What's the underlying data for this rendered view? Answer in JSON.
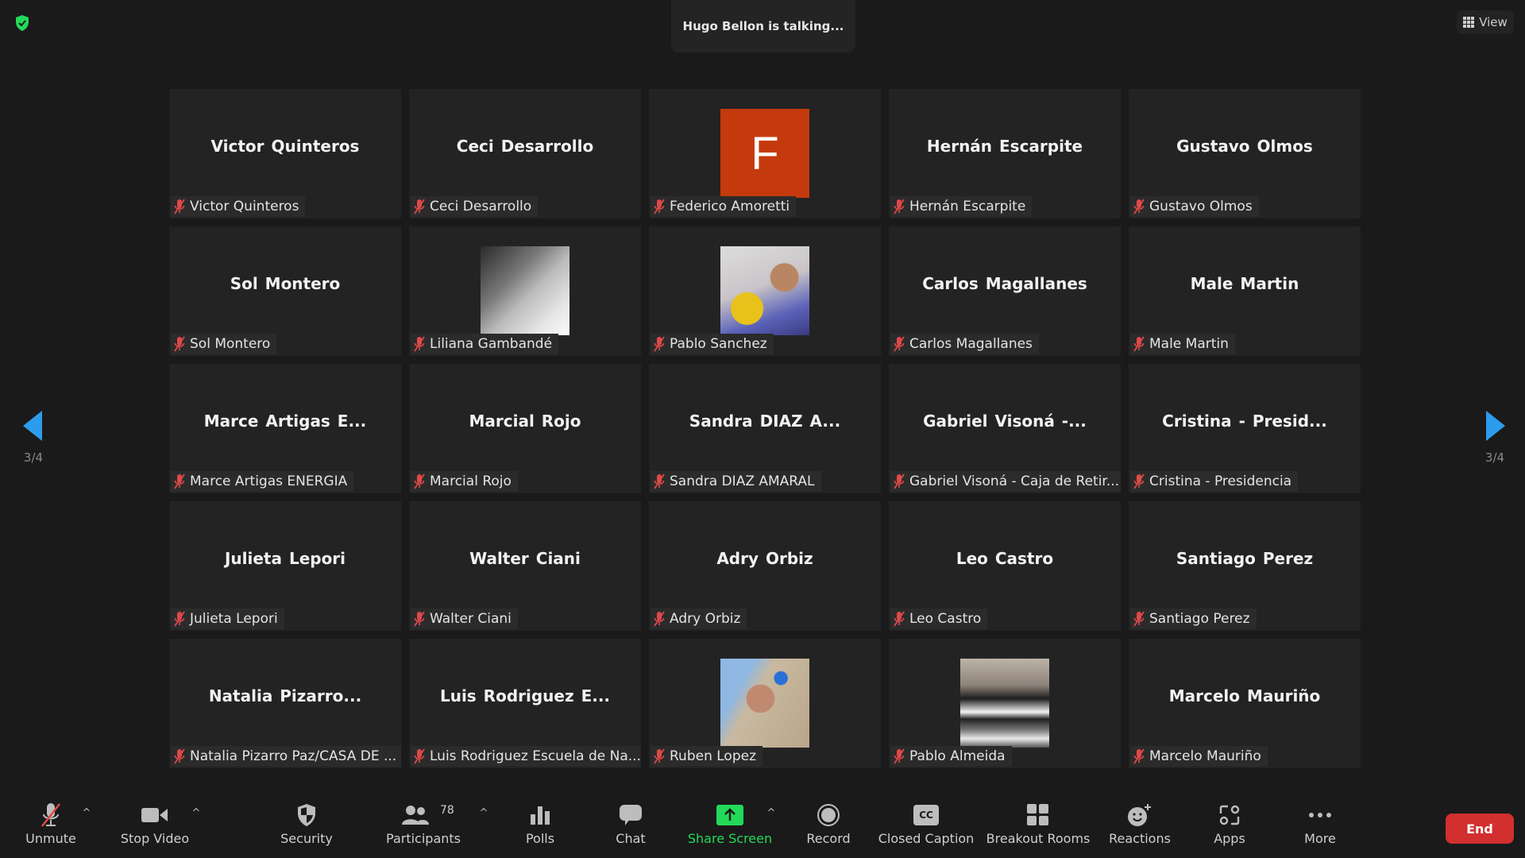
{
  "top": {
    "talking_indicator": "Hugo Bellon is talking...",
    "view_label": "View"
  },
  "pager": {
    "left_page": "3/4",
    "right_page": "3/4"
  },
  "tiles": [
    {
      "display": "Victor Quinteros",
      "label": "Victor Quinteros"
    },
    {
      "display": "Ceci Desarrollo",
      "label": "Ceci Desarrollo"
    },
    {
      "display": "",
      "avatar_letter": "F",
      "label": "Federico Amoretti"
    },
    {
      "display": "Hernán Escarpite",
      "label": "Hernán Escarpite"
    },
    {
      "display": "Gustavo Olmos",
      "label": "Gustavo Olmos"
    },
    {
      "display": "Sol Montero",
      "label": "Sol Montero"
    },
    {
      "display": "",
      "photo": "bw-woman-photo",
      "label": "Liliana Gambandé"
    },
    {
      "display": "",
      "photo": "plantamos-memoria-photo",
      "label": "Pablo Sanchez"
    },
    {
      "display": "Carlos Magallanes",
      "label": "Carlos Magallanes"
    },
    {
      "display": "Male Martin",
      "label": "Male Martin"
    },
    {
      "display": "Marce Artigas E...",
      "label": "Marce Artigas ENERGIA"
    },
    {
      "display": "Marcial Rojo",
      "label": "Marcial Rojo"
    },
    {
      "display": "Sandra DIAZ A...",
      "label": "Sandra DIAZ AMARAL"
    },
    {
      "display": "Gabriel Visoná -...",
      "label": "Gabriel Visoná - Caja de Retir..."
    },
    {
      "display": "Cristina - Presid...",
      "label": "Cristina - Presidencia"
    },
    {
      "display": "Julieta Lepori",
      "label": "Julieta Lepori"
    },
    {
      "display": "Walter Ciani",
      "label": "Walter Ciani"
    },
    {
      "display": "Adry Orbiz",
      "label": "Adry Orbiz"
    },
    {
      "display": "Leo Castro",
      "label": "Leo Castro"
    },
    {
      "display": "Santiago Perez",
      "label": "Santiago Perez"
    },
    {
      "display": "Natalia Pizarro...",
      "label": "Natalia Pizarro Paz/CASA DE ..."
    },
    {
      "display": "Luis Rodriguez E...",
      "label": "Luis Rodriguez Escuela de Na..."
    },
    {
      "display": "",
      "photo": "man-sunglasses-photo",
      "label": "Ruben Lopez"
    },
    {
      "display": "",
      "photo": "lucha-y-unidad-banner-photo",
      "label": "Pablo Almeida"
    },
    {
      "display": "Marcelo Mauriño",
      "label": "Marcelo Mauriño"
    }
  ],
  "toolbar": {
    "unmute": "Unmute",
    "stop_video": "Stop Video",
    "security": "Security",
    "participants": "Participants",
    "participants_count": "78",
    "polls": "Polls",
    "chat": "Chat",
    "share_screen": "Share Screen",
    "record": "Record",
    "closed_caption": "Closed Caption",
    "cc_glyph": "CC",
    "breakout_rooms": "Breakout Rooms",
    "reactions": "Reactions",
    "apps": "Apps",
    "more": "More",
    "end": "End"
  },
  "colors": {
    "background": "#1a1a1a",
    "tile": "#232323",
    "accent_blue": "#2d9cec",
    "share_green": "#23d959",
    "end_red": "#d22f2f",
    "muted_red": "#e04848",
    "avatar_orange": "#c43a0c"
  }
}
